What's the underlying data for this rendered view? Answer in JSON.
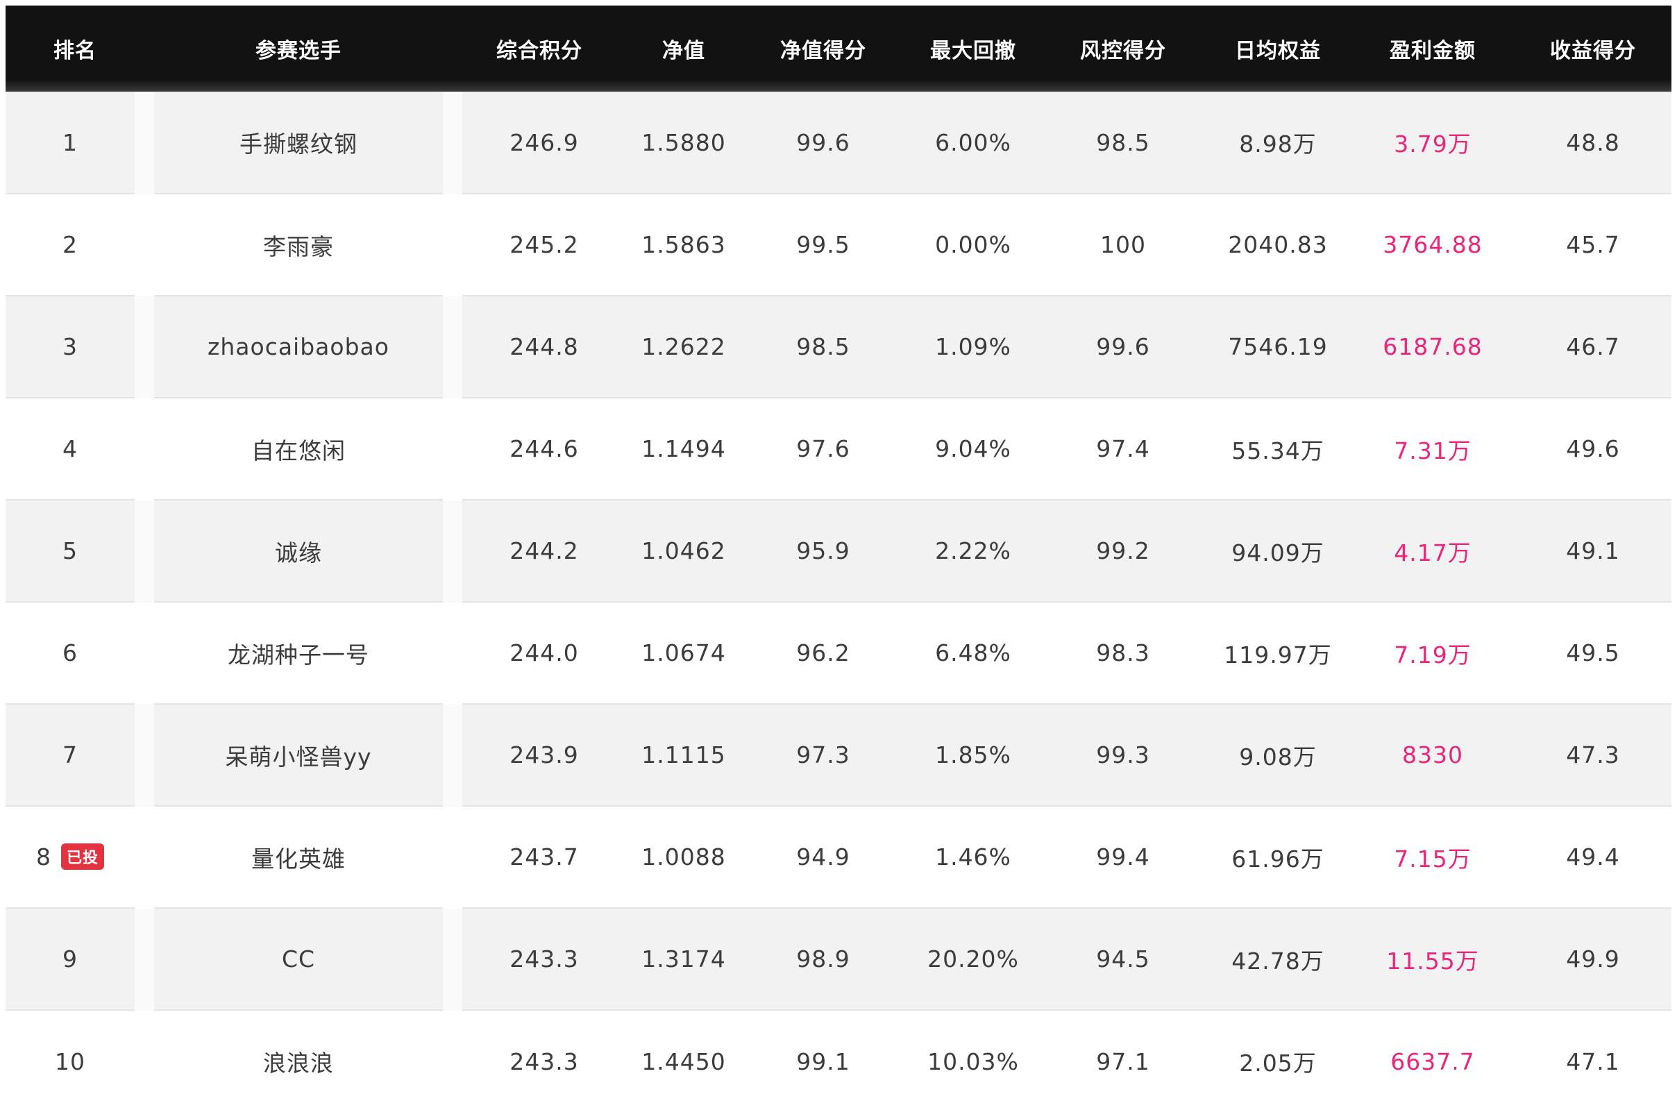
{
  "table": {
    "headers": {
      "rank": "排名",
      "player": "参赛选手",
      "score": "综合积分",
      "nav": "净值",
      "nav_score": "净值得分",
      "max_drawdown": "最大回撤",
      "risk_score": "风控得分",
      "avg_equity": "日均权益",
      "profit": "盈利金额",
      "return_score": "收益得分"
    },
    "rows": [
      {
        "rank": "1",
        "player": "手撕螺纹钢",
        "score": "246.9",
        "nav": "1.5880",
        "nav_score": "99.6",
        "max_drawdown": "6.00%",
        "risk_score": "98.5",
        "avg_equity": "8.98万",
        "profit": "3.79万",
        "return_score": "48.8"
      },
      {
        "rank": "2",
        "player": "李雨豪",
        "score": "245.2",
        "nav": "1.5863",
        "nav_score": "99.5",
        "max_drawdown": "0.00%",
        "risk_score": "100",
        "avg_equity": "2040.83",
        "profit": "3764.88",
        "return_score": "45.7"
      },
      {
        "rank": "3",
        "player": "zhaocaibaobao",
        "score": "244.8",
        "nav": "1.2622",
        "nav_score": "98.5",
        "max_drawdown": "1.09%",
        "risk_score": "99.6",
        "avg_equity": "7546.19",
        "profit": "6187.68",
        "return_score": "46.7"
      },
      {
        "rank": "4",
        "player": "自在悠闲",
        "score": "244.6",
        "nav": "1.1494",
        "nav_score": "97.6",
        "max_drawdown": "9.04%",
        "risk_score": "97.4",
        "avg_equity": "55.34万",
        "profit": "7.31万",
        "return_score": "49.6"
      },
      {
        "rank": "5",
        "player": "诚缘",
        "score": "244.2",
        "nav": "1.0462",
        "nav_score": "95.9",
        "max_drawdown": "2.22%",
        "risk_score": "99.2",
        "avg_equity": "94.09万",
        "profit": "4.17万",
        "return_score": "49.1"
      },
      {
        "rank": "6",
        "player": "龙湖种子一号",
        "score": "244.0",
        "nav": "1.0674",
        "nav_score": "96.2",
        "max_drawdown": "6.48%",
        "risk_score": "98.3",
        "avg_equity": "119.97万",
        "profit": "7.19万",
        "return_score": "49.5"
      },
      {
        "rank": "7",
        "player": "呆萌小怪兽yy",
        "score": "243.9",
        "nav": "1.1115",
        "nav_score": "97.3",
        "max_drawdown": "1.85%",
        "risk_score": "99.3",
        "avg_equity": "9.08万",
        "profit": "8330",
        "return_score": "47.3"
      },
      {
        "rank": "8",
        "badge": "已投",
        "player": "量化英雄",
        "score": "243.7",
        "nav": "1.0088",
        "nav_score": "94.9",
        "max_drawdown": "1.46%",
        "risk_score": "99.4",
        "avg_equity": "61.96万",
        "profit": "7.15万",
        "return_score": "49.4"
      },
      {
        "rank": "9",
        "player": "CC",
        "score": "243.3",
        "nav": "1.3174",
        "nav_score": "98.9",
        "max_drawdown": "20.20%",
        "risk_score": "94.5",
        "avg_equity": "42.78万",
        "profit": "11.55万",
        "return_score": "49.9"
      },
      {
        "rank": "10",
        "player": "浪浪浪",
        "score": "243.3",
        "nav": "1.4450",
        "nav_score": "99.1",
        "max_drawdown": "10.03%",
        "risk_score": "97.1",
        "avg_equity": "2.05万",
        "profit": "6637.7",
        "return_score": "47.1"
      }
    ]
  },
  "colors": {
    "header_bg": "#121212",
    "header_text": "#ffffff",
    "row_alt_bg": "#f2f2f2",
    "profit_text": "#e8267a",
    "badge_bg": "#e3313f"
  }
}
